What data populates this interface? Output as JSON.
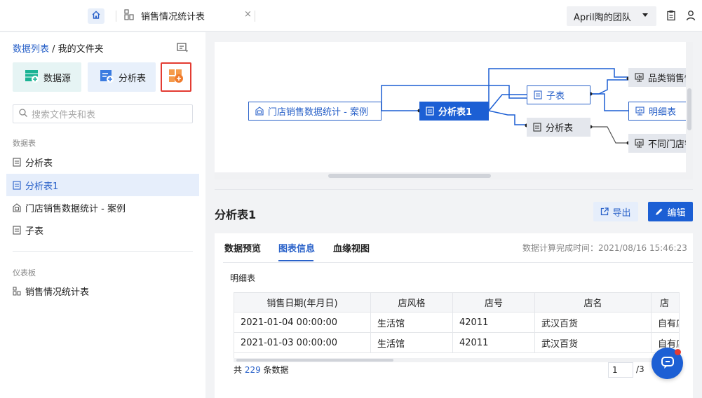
{
  "topbar": {
    "tab_label": "销售情况统计表",
    "tab_close": "×",
    "team_name": "April陶的团队"
  },
  "left": {
    "breadcrumb_root": "数据列表",
    "breadcrumb_sep": " / ",
    "breadcrumb_current": "我的文件夹",
    "create_datasource": "数据源",
    "create_analysis": "分析表",
    "search_placeholder": "搜索文件夹和表",
    "section_tables": "数据表",
    "tables": [
      {
        "label": "分析表",
        "icon": "table-icon"
      },
      {
        "label": "分析表1",
        "icon": "table-icon",
        "active": true
      },
      {
        "label": "门店销售数据统计 - 案例",
        "icon": "datasource-icon"
      },
      {
        "label": "子表",
        "icon": "table-icon"
      }
    ],
    "section_dashboards": "仪表板",
    "dashboards": [
      {
        "label": "销售情况统计表",
        "icon": "dashboard-icon"
      }
    ]
  },
  "lineage": {
    "source": "门店销售数据统计 - 案例",
    "center": "分析表1",
    "child_sub": "子表",
    "child_analysis": "分析表",
    "dash_1": "品类销售情",
    "dash_2": "明细表",
    "dash_3": "不同门店销"
  },
  "detail": {
    "title": "分析表1",
    "export_label": "导出",
    "edit_label": "编辑",
    "tabs": [
      "数据预览",
      "图表信息",
      "血缘视图"
    ],
    "active_tab": "图表信息",
    "calc_time": "数据计算完成时间：2021/08/16 15:46:23",
    "sub_heading": "明细表",
    "columns": [
      "销售日期(年月日)",
      "店风格",
      "店号",
      "店名",
      "店"
    ],
    "rows": [
      [
        "2021-01-04 00:00:00",
        "生活馆",
        "42011",
        "武汉百货",
        "自有店"
      ],
      [
        "2021-01-03 00:00:00",
        "生活馆",
        "42011",
        "武汉百货",
        "自有店"
      ]
    ],
    "total_prefix": "共 ",
    "total_count": "229",
    "total_suffix": " 条数据",
    "page_current": "1",
    "page_total": "/3"
  },
  "colors": {
    "brand": "#1c5fd4",
    "link": "#2a62c9",
    "highlight_border": "#e33b32"
  }
}
